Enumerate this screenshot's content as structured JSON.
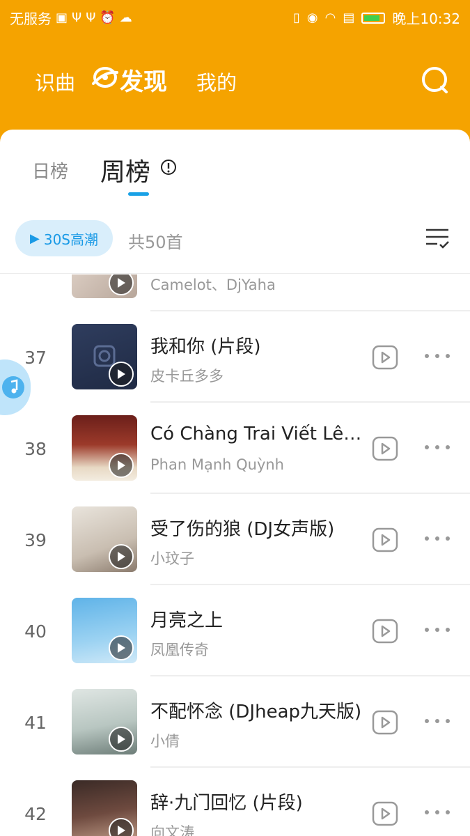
{
  "status_bar": {
    "carrier": "无服务",
    "time": "晚上10:32",
    "left_icons": [
      "sim-icon",
      "usb-icon",
      "usb-icon",
      "alarm-icon",
      "cloud-icon"
    ],
    "right_icons": [
      "vibrate-icon",
      "eye-icon",
      "wifi-icon",
      "sim-lock-icon",
      "battery-icon"
    ]
  },
  "nav": {
    "items": [
      {
        "label": "识曲"
      },
      {
        "label": "发现"
      },
      {
        "label": "我的"
      }
    ],
    "active": "发现"
  },
  "tabs": {
    "daily": "日榜",
    "weekly": "周榜",
    "active": "周榜"
  },
  "toolbar": {
    "chip_label": "30S高潮",
    "total": "共50首"
  },
  "songs": [
    {
      "rank": "",
      "title": "",
      "artist": "Camelot、DjYaha"
    },
    {
      "rank": "37",
      "title": "我和你 (片段)",
      "artist": "皮卡丘多多"
    },
    {
      "rank": "38",
      "title": "Có Chàng Trai Viết Lên Cây",
      "artist": "Phan Mạnh Quỳnh"
    },
    {
      "rank": "39",
      "title": "受了伤的狼 (DJ女声版)",
      "artist": "小玟子"
    },
    {
      "rank": "40",
      "title": "月亮之上",
      "artist": "凤凰传奇"
    },
    {
      "rank": "41",
      "title": "不配怀念 (DJheap九天版)",
      "artist": "小倩"
    },
    {
      "rank": "42",
      "title": "辞·九门回忆 (片段)",
      "artist": "向文涛"
    }
  ],
  "colors": {
    "brand_orange": "#f5a300",
    "accent_blue": "#1a9ae6",
    "chip_bg": "#d9eefb"
  }
}
